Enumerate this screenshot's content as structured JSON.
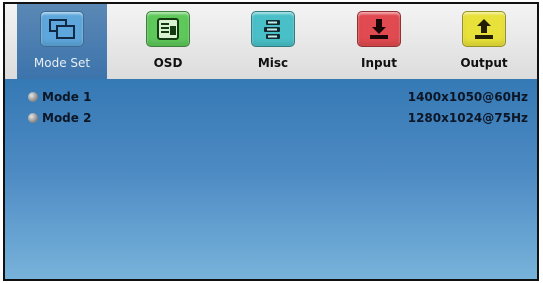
{
  "tabs": [
    {
      "label": "Mode Set",
      "icon": "windows-icon",
      "color": "#5ea7dd",
      "active": true
    },
    {
      "label": "OSD",
      "icon": "osd-menu-icon",
      "color": "#5ec85a",
      "active": false
    },
    {
      "label": "Misc",
      "icon": "misc-stack-icon",
      "color": "#49c0c8",
      "active": false
    },
    {
      "label": "Input",
      "icon": "input-download-icon",
      "color": "#e04a50",
      "active": false
    },
    {
      "label": "Output",
      "icon": "output-upload-icon",
      "color": "#e8e13a",
      "active": false
    }
  ],
  "modes": [
    {
      "name": "Mode 1",
      "resolution": "1400x1050@60Hz"
    },
    {
      "name": "Mode 2",
      "resolution": "1280x1024@75Hz"
    }
  ],
  "colors": {
    "active_tab": "#3c74ac",
    "content_top": "#3579b4",
    "content_bottom": "#79b4db"
  }
}
